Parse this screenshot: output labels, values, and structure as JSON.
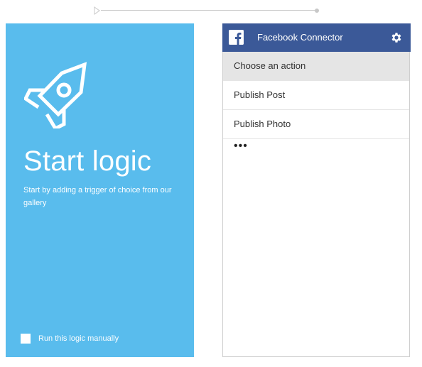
{
  "trigger_card": {
    "title": "Start logic",
    "description": "Start by adding a trigger of choice from our gallery",
    "manual_label": "Run this logic manually",
    "manual_checked": false,
    "background": "#59bced",
    "icon": "rocket-icon"
  },
  "connector_card": {
    "title": "Facebook Connector",
    "header_color": "#3b5998",
    "icons": {
      "brand": "facebook-icon",
      "settings": "gear-icon"
    },
    "actions": {
      "placeholder": "Choose an action",
      "items": [
        "Publish Post",
        "Publish Photo"
      ],
      "more": "•••"
    }
  }
}
